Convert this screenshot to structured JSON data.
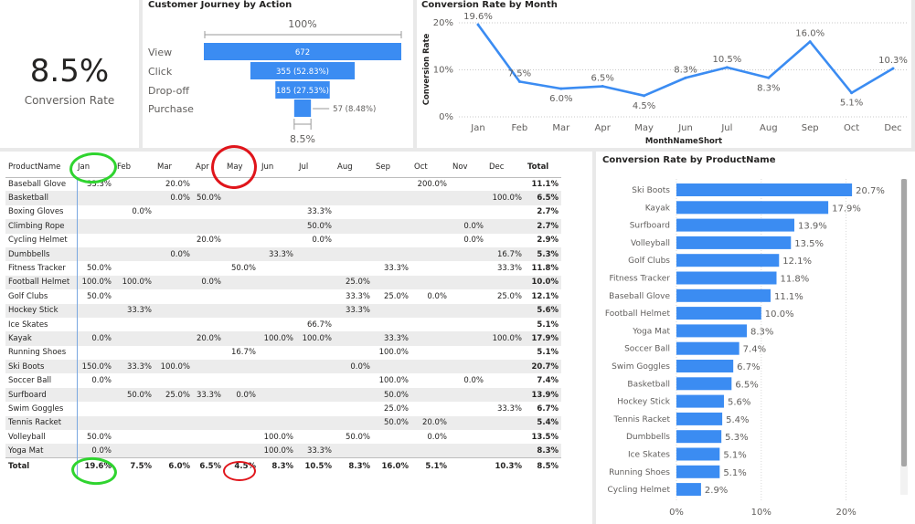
{
  "kpi": {
    "value": "8.5%",
    "label": "Conversion Rate"
  },
  "funnel": {
    "title": "Customer Journey by Action",
    "top_label": "100%",
    "bottom_label": "8.5%",
    "stages": [
      {
        "label": "View",
        "value": 672,
        "text": "672"
      },
      {
        "label": "Click",
        "value": 355,
        "text": "355 (52.83%)"
      },
      {
        "label": "Drop-off",
        "value": 185,
        "text": "185 (27.53%)"
      },
      {
        "label": "Purchase",
        "value": 57,
        "text": "57 (8.48%)"
      }
    ],
    "bar_color": "#3b8cf2"
  },
  "line_chart": {
    "title": "Conversion Rate by Month",
    "chart_data": {
      "type": "line",
      "title": "Conversion Rate by Month",
      "xlabel": "MonthNameShort",
      "ylabel": "Conversion Rate",
      "categories": [
        "Jan",
        "Feb",
        "Mar",
        "Apr",
        "May",
        "Jun",
        "Jul",
        "Aug",
        "Sep",
        "Oct",
        "Dec"
      ],
      "values": [
        19.6,
        7.5,
        6.0,
        6.5,
        4.5,
        8.3,
        10.5,
        8.3,
        16.0,
        5.1,
        10.3
      ],
      "labels": [
        "19.6%",
        "7.5%",
        "6.0%",
        "6.5%",
        "4.5%",
        "8.3%",
        "10.5%",
        "8.3%",
        "16.0%",
        "5.1%",
        "10.3%"
      ],
      "yticks": [
        "0%",
        "10%",
        "20%"
      ],
      "ylim": [
        0,
        20
      ],
      "color": "#3b8cf2"
    }
  },
  "matrix": {
    "headers": [
      "ProductName",
      "Jan",
      "Feb",
      "Mar",
      "Apr",
      "May",
      "Jun",
      "Jul",
      "Aug",
      "Sep",
      "Oct",
      "Nov",
      "Dec",
      "Total"
    ],
    "rows": [
      [
        "Baseball Glove",
        "33.3%",
        "",
        "20.0%",
        "",
        "",
        "",
        "",
        "",
        "",
        "200.0%",
        "",
        "",
        "11.1%"
      ],
      [
        "Basketball",
        "",
        "",
        "0.0%",
        "50.0%",
        "",
        "",
        "",
        "",
        "",
        "",
        "",
        "100.0%",
        "6.5%"
      ],
      [
        "Boxing Gloves",
        "",
        "0.0%",
        "",
        "",
        "",
        "",
        "33.3%",
        "",
        "",
        "",
        "",
        "",
        "2.7%"
      ],
      [
        "Climbing Rope",
        "",
        "",
        "",
        "",
        "",
        "",
        "50.0%",
        "",
        "",
        "",
        "0.0%",
        "",
        "2.7%"
      ],
      [
        "Cycling Helmet",
        "",
        "",
        "",
        "20.0%",
        "",
        "",
        "0.0%",
        "",
        "",
        "",
        "0.0%",
        "",
        "2.9%"
      ],
      [
        "Dumbbells",
        "",
        "",
        "0.0%",
        "",
        "",
        "33.3%",
        "",
        "",
        "",
        "",
        "",
        "16.7%",
        "5.3%"
      ],
      [
        "Fitness Tracker",
        "50.0%",
        "",
        "",
        "",
        "50.0%",
        "",
        "",
        "",
        "33.3%",
        "",
        "",
        "33.3%",
        "11.8%"
      ],
      [
        "Football Helmet",
        "100.0%",
        "100.0%",
        "",
        "0.0%",
        "",
        "",
        "",
        "25.0%",
        "",
        "",
        "",
        "",
        "10.0%"
      ],
      [
        "Golf Clubs",
        "50.0%",
        "",
        "",
        "",
        "",
        "",
        "",
        "33.3%",
        "25.0%",
        "0.0%",
        "",
        "25.0%",
        "12.1%"
      ],
      [
        "Hockey Stick",
        "",
        "33.3%",
        "",
        "",
        "",
        "",
        "",
        "33.3%",
        "",
        "",
        "",
        "",
        "5.6%"
      ],
      [
        "Ice Skates",
        "",
        "",
        "",
        "",
        "",
        "",
        "66.7%",
        "",
        "",
        "",
        "",
        "",
        "5.1%"
      ],
      [
        "Kayak",
        "0.0%",
        "",
        "",
        "20.0%",
        "",
        "100.0%",
        "100.0%",
        "",
        "33.3%",
        "",
        "",
        "100.0%",
        "17.9%"
      ],
      [
        "Running Shoes",
        "",
        "",
        "",
        "",
        "16.7%",
        "",
        "",
        "",
        "100.0%",
        "",
        "",
        "",
        "5.1%"
      ],
      [
        "Ski Boots",
        "150.0%",
        "33.3%",
        "100.0%",
        "",
        "",
        "",
        "",
        "0.0%",
        "",
        "",
        "",
        "",
        "20.7%"
      ],
      [
        "Soccer Ball",
        "0.0%",
        "",
        "",
        "",
        "",
        "",
        "",
        "",
        "100.0%",
        "",
        "0.0%",
        "",
        "7.4%"
      ],
      [
        "Surfboard",
        "",
        "50.0%",
        "25.0%",
        "33.3%",
        "0.0%",
        "",
        "",
        "",
        "50.0%",
        "",
        "",
        "",
        "13.9%"
      ],
      [
        "Swim Goggles",
        "",
        "",
        "",
        "",
        "",
        "",
        "",
        "",
        "25.0%",
        "",
        "",
        "33.3%",
        "6.7%"
      ],
      [
        "Tennis Racket",
        "",
        "",
        "",
        "",
        "",
        "",
        "",
        "",
        "50.0%",
        "20.0%",
        "",
        "",
        "5.4%"
      ],
      [
        "Volleyball",
        "50.0%",
        "",
        "",
        "",
        "",
        "100.0%",
        "",
        "50.0%",
        "",
        "0.0%",
        "",
        "",
        "13.5%"
      ],
      [
        "Yoga Mat",
        "0.0%",
        "",
        "",
        "",
        "",
        "100.0%",
        "33.3%",
        "",
        "",
        "",
        "",
        "",
        "8.3%"
      ]
    ],
    "total_row": [
      "Total",
      "19.6%",
      "7.5%",
      "6.0%",
      "6.5%",
      "4.5%",
      "8.3%",
      "10.5%",
      "8.3%",
      "16.0%",
      "5.1%",
      "",
      "10.3%",
      "8.5%"
    ]
  },
  "bar_chart": {
    "title": "Conversion Rate by ProductName",
    "chart_data": {
      "type": "bar",
      "orientation": "horizontal",
      "title": "Conversion Rate by ProductName",
      "categories": [
        "Ski Boots",
        "Kayak",
        "Surfboard",
        "Volleyball",
        "Golf Clubs",
        "Fitness Tracker",
        "Baseball Glove",
        "Football Helmet",
        "Yoga Mat",
        "Soccer Ball",
        "Swim Goggles",
        "Basketball",
        "Hockey Stick",
        "Tennis Racket",
        "Dumbbells",
        "Ice Skates",
        "Running Shoes",
        "Cycling Helmet"
      ],
      "values": [
        20.7,
        17.9,
        13.9,
        13.5,
        12.1,
        11.8,
        11.1,
        10.0,
        8.3,
        7.4,
        6.7,
        6.5,
        5.6,
        5.4,
        5.3,
        5.1,
        5.1,
        2.9
      ],
      "labels": [
        "20.7%",
        "17.9%",
        "13.9%",
        "13.5%",
        "12.1%",
        "11.8%",
        "11.1%",
        "10.0%",
        "8.3%",
        "7.4%",
        "6.7%",
        "6.5%",
        "5.6%",
        "5.4%",
        "5.3%",
        "5.1%",
        "5.1%",
        "2.9%"
      ],
      "xticks": [
        "0%",
        "10%",
        "20%"
      ],
      "xlim": [
        0,
        20
      ],
      "color": "#3b8cf2"
    }
  },
  "annotations": {
    "green": "#2fd42f",
    "red": "#e0151b"
  }
}
